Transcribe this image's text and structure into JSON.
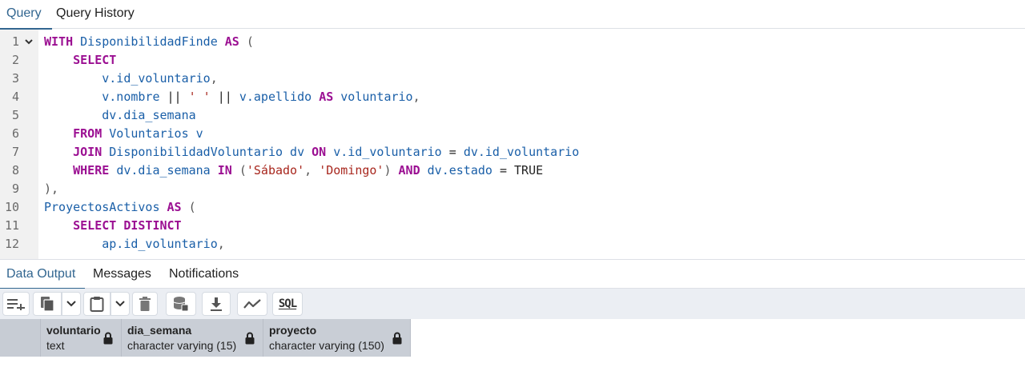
{
  "top_tabs": [
    {
      "label": "Query",
      "active": true
    },
    {
      "label": "Query History",
      "active": false
    }
  ],
  "editor": {
    "lines": [
      {
        "n": "1",
        "tokens": [
          [
            "kw",
            "WITH"
          ],
          [
            "pl",
            " "
          ],
          [
            "id",
            "DisponibilidadFinde"
          ],
          [
            "pl",
            " "
          ],
          [
            "kw",
            "AS"
          ],
          [
            "pl",
            " "
          ],
          [
            "mute",
            "("
          ]
        ]
      },
      {
        "n": "2",
        "tokens": [
          [
            "pl",
            "    "
          ],
          [
            "kw",
            "SELECT"
          ]
        ]
      },
      {
        "n": "3",
        "tokens": [
          [
            "pl",
            "        "
          ],
          [
            "id",
            "v.id_voluntario"
          ],
          [
            "mute",
            ","
          ]
        ]
      },
      {
        "n": "4",
        "tokens": [
          [
            "pl",
            "        "
          ],
          [
            "id",
            "v.nombre"
          ],
          [
            "pl",
            " || "
          ],
          [
            "str",
            "' '"
          ],
          [
            "pl",
            " || "
          ],
          [
            "id",
            "v.apellido"
          ],
          [
            "pl",
            " "
          ],
          [
            "kw",
            "AS"
          ],
          [
            "pl",
            " "
          ],
          [
            "id",
            "voluntario"
          ],
          [
            "mute",
            ","
          ]
        ]
      },
      {
        "n": "5",
        "tokens": [
          [
            "pl",
            "        "
          ],
          [
            "id",
            "dv.dia_semana"
          ]
        ]
      },
      {
        "n": "6",
        "tokens": [
          [
            "pl",
            "    "
          ],
          [
            "kw",
            "FROM"
          ],
          [
            "pl",
            " "
          ],
          [
            "id",
            "Voluntarios v"
          ]
        ]
      },
      {
        "n": "7",
        "tokens": [
          [
            "pl",
            "    "
          ],
          [
            "kw",
            "JOIN"
          ],
          [
            "pl",
            " "
          ],
          [
            "id",
            "DisponibilidadVoluntario dv"
          ],
          [
            "pl",
            " "
          ],
          [
            "kw",
            "ON"
          ],
          [
            "pl",
            " "
          ],
          [
            "id",
            "v.id_voluntario"
          ],
          [
            "pl",
            " = "
          ],
          [
            "id",
            "dv.id_voluntario"
          ]
        ]
      },
      {
        "n": "8",
        "tokens": [
          [
            "pl",
            "    "
          ],
          [
            "kw",
            "WHERE"
          ],
          [
            "pl",
            " "
          ],
          [
            "id",
            "dv.dia_semana"
          ],
          [
            "pl",
            " "
          ],
          [
            "kw",
            "IN"
          ],
          [
            "pl",
            " "
          ],
          [
            "mute",
            "("
          ],
          [
            "str",
            "'Sábado'"
          ],
          [
            "mute",
            ", "
          ],
          [
            "str",
            "'Domingo'"
          ],
          [
            "mute",
            ")"
          ],
          [
            "pl",
            " "
          ],
          [
            "kw",
            "AND"
          ],
          [
            "pl",
            " "
          ],
          [
            "id",
            "dv.estado"
          ],
          [
            "pl",
            " = TRUE"
          ]
        ]
      },
      {
        "n": "9",
        "tokens": [
          [
            "mute",
            "),"
          ]
        ]
      },
      {
        "n": "10",
        "tokens": [
          [
            "id",
            "ProyectosActivos"
          ],
          [
            "pl",
            " "
          ],
          [
            "kw",
            "AS"
          ],
          [
            "pl",
            " "
          ],
          [
            "mute",
            "("
          ]
        ]
      },
      {
        "n": "11",
        "tokens": [
          [
            "pl",
            "    "
          ],
          [
            "kw",
            "SELECT DISTINCT"
          ]
        ]
      },
      {
        "n": "12",
        "tokens": [
          [
            "pl",
            "        "
          ],
          [
            "id",
            "ap.id_voluntario"
          ],
          [
            "mute",
            ","
          ]
        ]
      }
    ]
  },
  "bottom_tabs": [
    {
      "label": "Data Output",
      "active": true
    },
    {
      "label": "Messages",
      "active": false
    },
    {
      "label": "Notifications",
      "active": false
    }
  ],
  "toolbar": {
    "sql_label": "SQL",
    "icons": [
      "add-row-icon",
      "copy-icon",
      "chevron-down-icon",
      "paste-icon",
      "chevron-down-icon",
      "delete-icon",
      "save-data-icon",
      "download-icon",
      "graph-icon",
      "sql-icon"
    ]
  },
  "columns": [
    {
      "name": "voluntario",
      "type": "text"
    },
    {
      "name": "dia_semana",
      "type": "character varying (15)"
    },
    {
      "name": "proyecto",
      "type": "character varying (150)"
    }
  ],
  "colors": {
    "accent": "#326690",
    "keyword": "#9b0f92",
    "identifier": "#1a5fa8",
    "string": "#a8271e"
  }
}
